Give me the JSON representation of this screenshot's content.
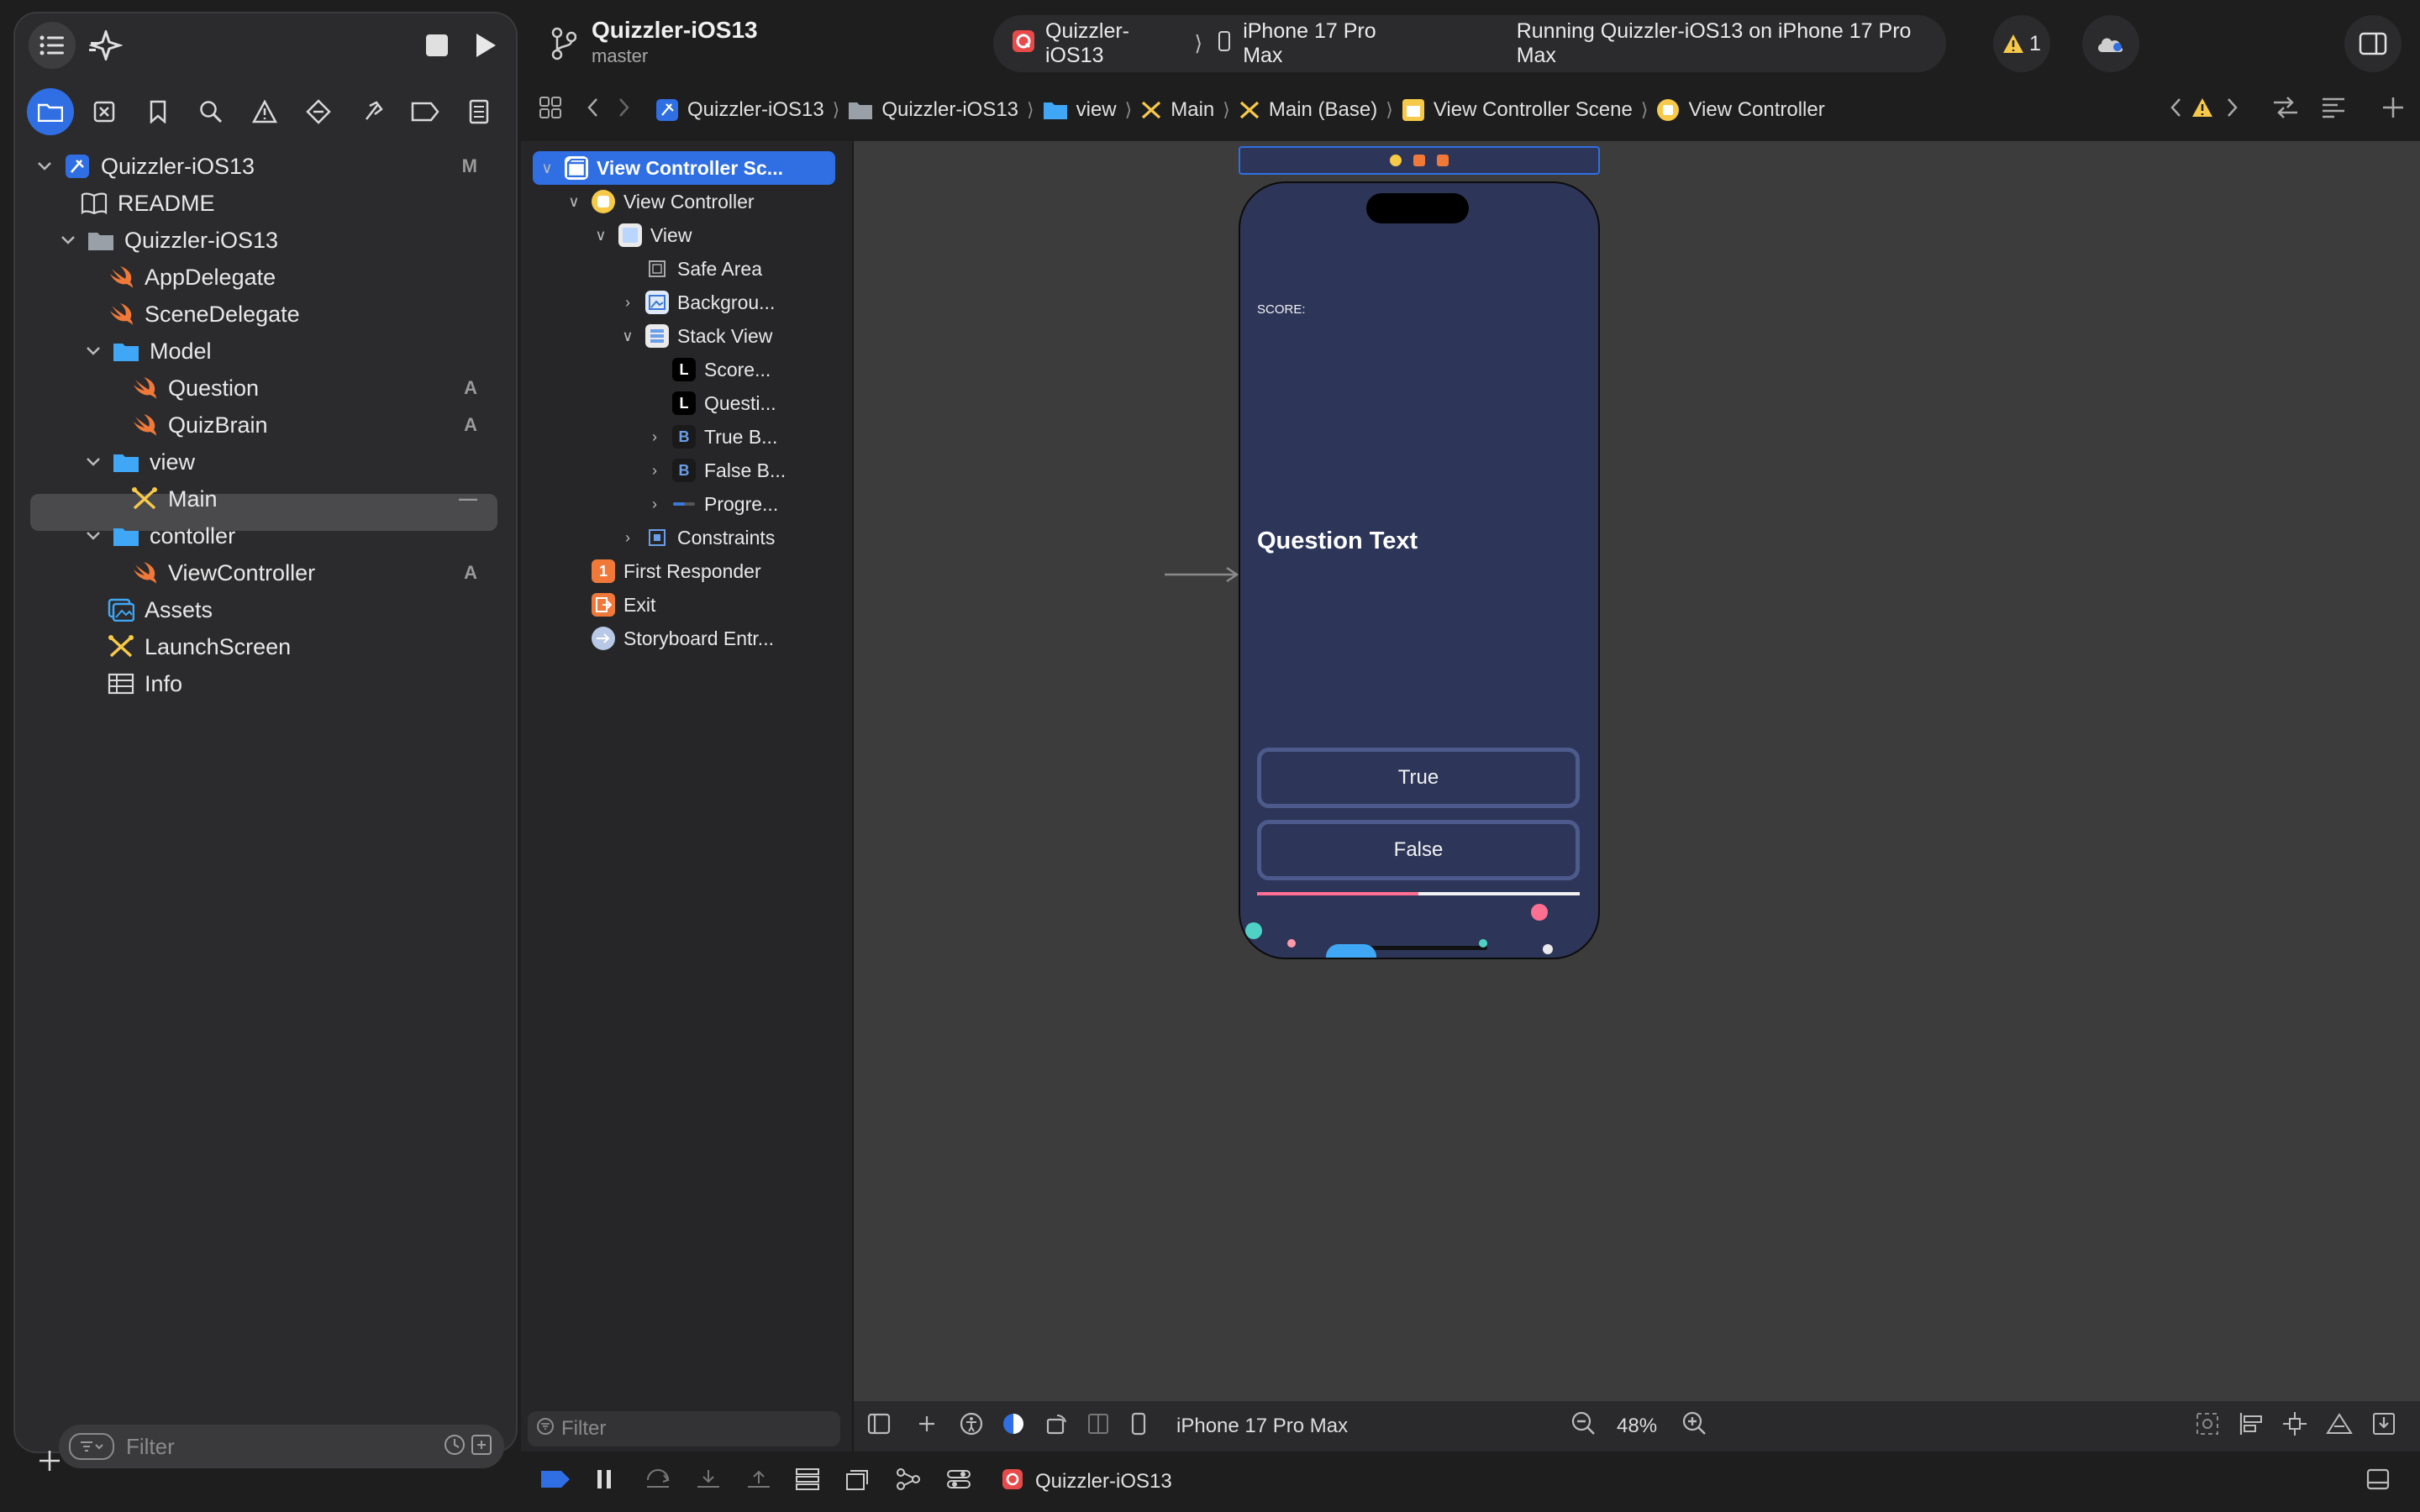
{
  "window": {
    "project_title": "Quizzler-iOS13",
    "branch": "master"
  },
  "toolbar": {
    "stop_label": "stop-icon",
    "run_label": "play-icon",
    "scheme_name": "Quizzler-iOS13",
    "device_name": "iPhone 17 Pro Max",
    "status_text": "Running Quizzler-iOS13 on iPhone 17 Pro Max",
    "warning_count": "1"
  },
  "navigator": {
    "tabs": [
      "folder-icon",
      "source-control-icon",
      "bookmark-icon",
      "find-icon",
      "issue-icon",
      "test-icon",
      "debug-icon",
      "breakpoint-icon",
      "report-icon"
    ],
    "items": [
      {
        "label": "Quizzler-iOS13",
        "badge": "M"
      },
      {
        "label": "README",
        "badge": ""
      },
      {
        "label": "Quizzler-iOS13",
        "badge": ""
      },
      {
        "label": "AppDelegate",
        "badge": ""
      },
      {
        "label": "SceneDelegate",
        "badge": ""
      },
      {
        "label": "Model",
        "badge": ""
      },
      {
        "label": "Question",
        "badge": "A"
      },
      {
        "label": "QuizBrain",
        "badge": "A"
      },
      {
        "label": "view",
        "badge": ""
      },
      {
        "label": "Main",
        "badge": "—"
      },
      {
        "label": "contoller",
        "badge": ""
      },
      {
        "label": "ViewController",
        "badge": "A"
      },
      {
        "label": "Assets",
        "badge": ""
      },
      {
        "label": "LaunchScreen",
        "badge": ""
      },
      {
        "label": "Info",
        "badge": ""
      }
    ],
    "filter_placeholder": "Filter"
  },
  "jumpbar": {
    "crumbs": [
      "Quizzler-iOS13",
      "Quizzler-iOS13",
      "view",
      "Main",
      "Main (Base)",
      "View Controller Scene",
      "View Controller"
    ]
  },
  "outline": {
    "items": [
      "View Controller Sc...",
      "View Controller",
      "View",
      "Safe Area",
      "Backgrou...",
      "Stack View",
      "Score...",
      "Questi...",
      "True B...",
      "False B...",
      "Progre...",
      "Constraints",
      "First Responder",
      "Exit",
      "Storyboard Entr..."
    ],
    "filter_placeholder": "Filter"
  },
  "phone": {
    "score_label": "SCORE:",
    "question_text": "Question Text",
    "true_button": "True",
    "false_button": "False",
    "progress": 0.5,
    "background": "#2d3659",
    "accent_pink": "#ff6f91"
  },
  "canvas_bar": {
    "device": "iPhone 17 Pro Max",
    "zoom": "48%"
  },
  "debug_bar": {
    "target": "Quizzler-iOS13"
  },
  "colors": {
    "accent": "#2f6fe3",
    "swift_orange": "#f0793a",
    "folder_blue": "#3fa7f5",
    "warning_yellow": "#f7c948"
  }
}
